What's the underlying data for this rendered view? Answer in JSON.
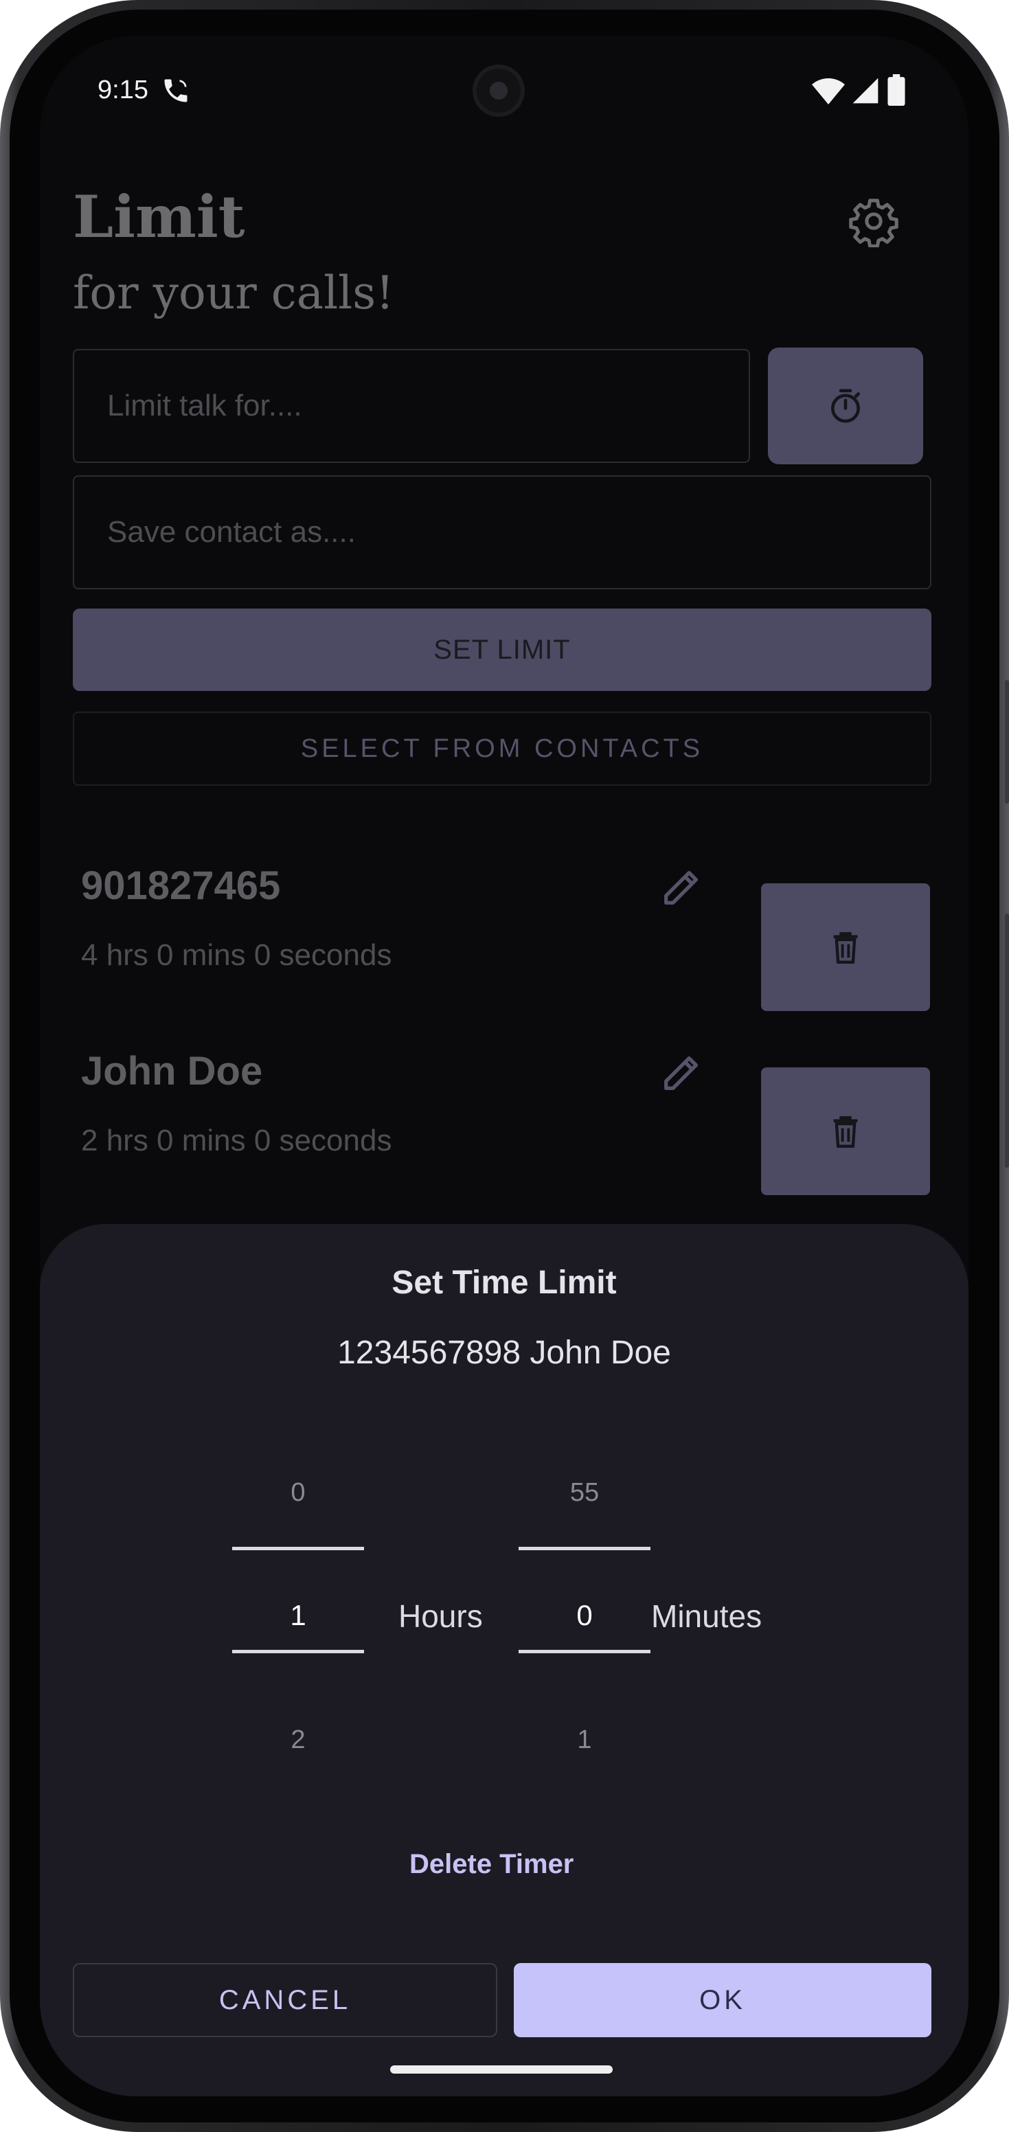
{
  "status_bar": {
    "time": "9:15"
  },
  "header": {
    "title": "Limit",
    "subtitle": "for your calls!"
  },
  "form": {
    "limit_placeholder": "Limit talk for....",
    "contact_placeholder": "Save contact as....",
    "set_limit_label": "SET LIMIT",
    "select_contacts_label": "SELECT FROM CONTACTS"
  },
  "contacts": [
    {
      "name": "901827465",
      "limit": "4 hrs 0 mins 0 seconds"
    },
    {
      "name": "John Doe",
      "limit": "2 hrs 0 mins 0 seconds"
    }
  ],
  "dialog": {
    "title": "Set Time Limit",
    "subtitle": "1234567898  John Doe",
    "hours": {
      "prev": "0",
      "current": "1",
      "next": "2",
      "unit": "Hours"
    },
    "minutes": {
      "prev": "55",
      "current": "0",
      "next": "1",
      "unit": "Minutes"
    },
    "delete_label": "Delete Timer",
    "cancel_label": "CANCEL",
    "ok_label": "OK"
  },
  "colors": {
    "accent": "#c6c2fa",
    "button_muted": "#4d4b63",
    "sheet_bg": "#1c1b23"
  }
}
